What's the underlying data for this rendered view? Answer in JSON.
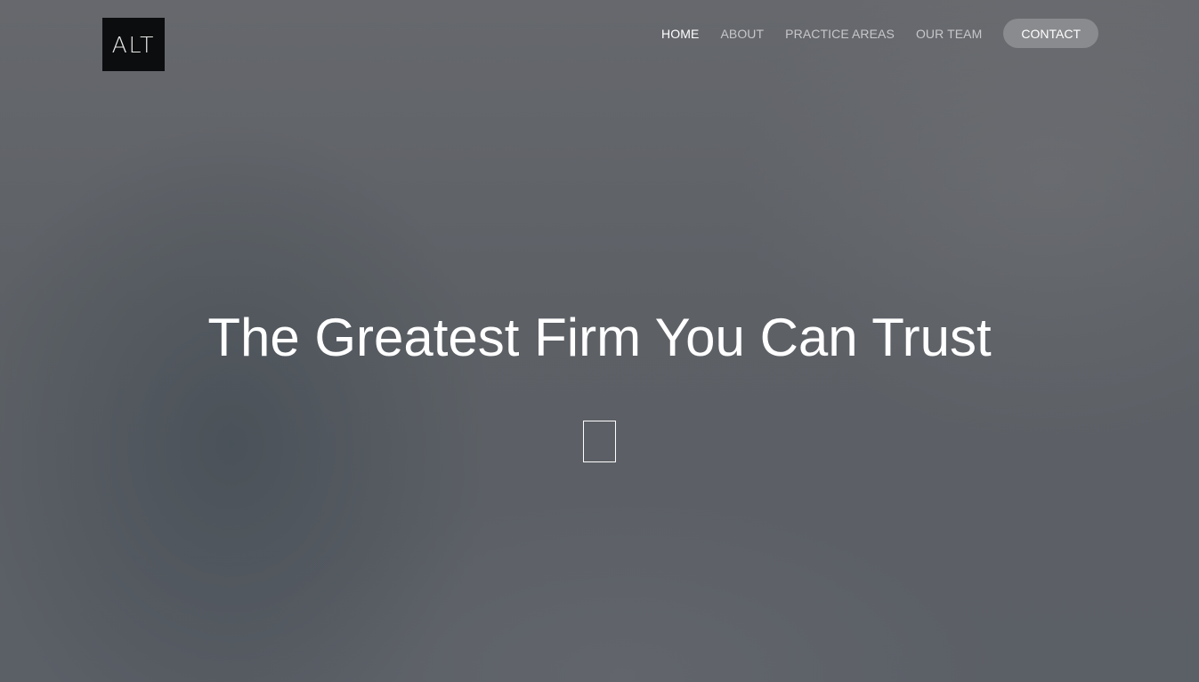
{
  "brand": {
    "logo_text": "ALT"
  },
  "nav": {
    "items": [
      {
        "label": "HOME",
        "active": true
      },
      {
        "label": "ABOUT",
        "active": false
      },
      {
        "label": "PRACTICE AREAS",
        "active": false
      },
      {
        "label": "OUR TEAM",
        "active": false
      }
    ],
    "contact_label": "CONTACT"
  },
  "hero": {
    "title": "The Greatest Firm You Can Trust",
    "scroll_icon": "missing-glyph-icon"
  },
  "colors": {
    "background": "#5c6066",
    "logo_bg": "#0c0d0e",
    "contact_button": "#8a8b8e",
    "nav_text": "#c6c7c9",
    "active_text": "#ffffff"
  }
}
